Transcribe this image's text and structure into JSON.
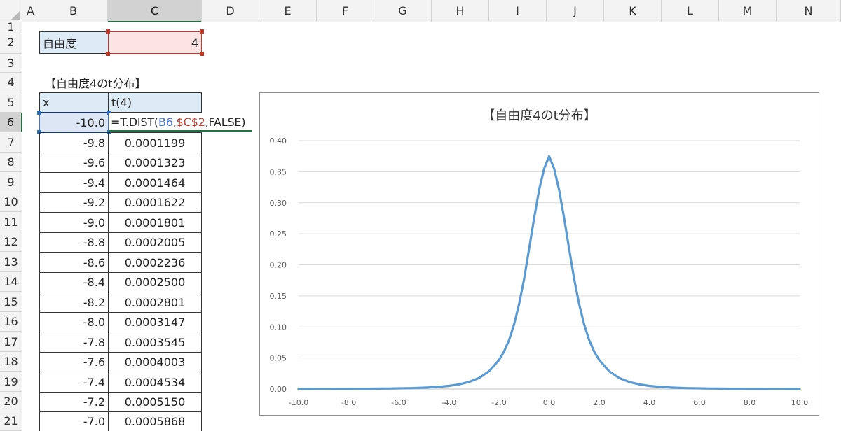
{
  "columns": [
    "A",
    "B",
    "C",
    "D",
    "E",
    "F",
    "G",
    "H",
    "I",
    "J",
    "K",
    "L",
    "M",
    "N"
  ],
  "rows": [
    "1",
    "2",
    "3",
    "4",
    "5",
    "6",
    "7",
    "8",
    "9",
    "10",
    "11",
    "12",
    "13",
    "14",
    "15",
    "16",
    "17",
    "18",
    "19",
    "20",
    "21"
  ],
  "param": {
    "label": "自由度",
    "value": "4"
  },
  "table": {
    "title": "【自由度4のt分布】",
    "header_x": "x",
    "header_t": "t(4)",
    "first_x": "-10.0",
    "formula": {
      "prefix": "=T.DIST(",
      "ref1": "B6",
      "comma": ",",
      "ref2": "$C$2",
      "suffix": ",FALSE)"
    },
    "rows": [
      {
        "x": "-9.8",
        "t": "0.0001199"
      },
      {
        "x": "-9.6",
        "t": "0.0001323"
      },
      {
        "x": "-9.4",
        "t": "0.0001464"
      },
      {
        "x": "-9.2",
        "t": "0.0001622"
      },
      {
        "x": "-9.0",
        "t": "0.0001801"
      },
      {
        "x": "-8.8",
        "t": "0.0002005"
      },
      {
        "x": "-8.6",
        "t": "0.0002236"
      },
      {
        "x": "-8.4",
        "t": "0.0002500"
      },
      {
        "x": "-8.2",
        "t": "0.0002801"
      },
      {
        "x": "-8.0",
        "t": "0.0003147"
      },
      {
        "x": "-7.8",
        "t": "0.0003545"
      },
      {
        "x": "-7.6",
        "t": "0.0004003"
      },
      {
        "x": "-7.4",
        "t": "0.0004534"
      },
      {
        "x": "-7.2",
        "t": "0.0005150"
      },
      {
        "x": "-7.0",
        "t": "0.0005868"
      }
    ]
  },
  "chart_data": {
    "type": "line",
    "title": "【自由度4のt分布】",
    "xlabel": "",
    "ylabel": "",
    "xlim": [
      -10,
      10
    ],
    "ylim": [
      0,
      0.4
    ],
    "x_ticks": [
      "-10.0",
      "-8.0",
      "-6.0",
      "-4.0",
      "-2.0",
      "0.0",
      "2.0",
      "4.0",
      "6.0",
      "8.0",
      "10.0"
    ],
    "y_ticks": [
      "0.00",
      "0.05",
      "0.10",
      "0.15",
      "0.20",
      "0.25",
      "0.30",
      "0.35",
      "0.40"
    ],
    "grid": true,
    "legend": "none",
    "color": "#5b9bd5",
    "series": [
      {
        "x": [
          -10.0,
          -9.6,
          -9.2,
          -8.8,
          -8.4,
          -8.0,
          -7.6,
          -7.2,
          -6.8,
          -6.4,
          -6.0,
          -5.6,
          -5.2,
          -4.8,
          -4.4,
          -4.0,
          -3.6,
          -3.2,
          -2.8,
          -2.4,
          -2.0,
          -1.8,
          -1.6,
          -1.4,
          -1.2,
          -1.0,
          -0.8,
          -0.6,
          -0.4,
          -0.2,
          0.0,
          0.2,
          0.4,
          0.6,
          0.8,
          1.0,
          1.2,
          1.4,
          1.6,
          1.8,
          2.0,
          2.4,
          2.8,
          3.2,
          3.6,
          4.0,
          4.4,
          4.8,
          5.2,
          5.6,
          6.0,
          6.4,
          6.8,
          7.2,
          7.6,
          8.0,
          8.4,
          8.8,
          9.2,
          9.6,
          10.0
        ],
        "values": [
          0.0001,
          0.0001,
          0.0002,
          0.0002,
          0.0003,
          0.0003,
          0.0004,
          0.0005,
          0.0007,
          0.0008,
          0.0011,
          0.0014,
          0.0019,
          0.0026,
          0.0036,
          0.0051,
          0.0075,
          0.0114,
          0.0177,
          0.0285,
          0.0466,
          0.0602,
          0.0787,
          0.1036,
          0.1365,
          0.1768,
          0.2254,
          0.2748,
          0.3206,
          0.3549,
          0.375,
          0.3549,
          0.3206,
          0.2748,
          0.2254,
          0.1768,
          0.1365,
          0.1036,
          0.0787,
          0.0602,
          0.0466,
          0.0285,
          0.0177,
          0.0114,
          0.0075,
          0.0051,
          0.0036,
          0.0026,
          0.0019,
          0.0014,
          0.0011,
          0.0008,
          0.0007,
          0.0005,
          0.0004,
          0.0003,
          0.0003,
          0.0002,
          0.0002,
          0.0001,
          0.0001
        ]
      }
    ]
  }
}
